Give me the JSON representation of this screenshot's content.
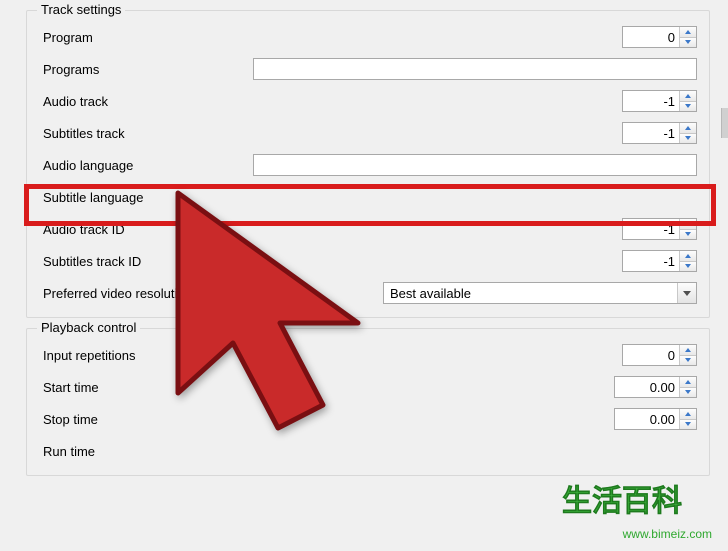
{
  "groups": {
    "track": {
      "title": "Track settings",
      "program": {
        "label": "Program",
        "value": "0"
      },
      "programs": {
        "label": "Programs",
        "value": ""
      },
      "audio_track": {
        "label": "Audio track",
        "value": "-1"
      },
      "subtitles_track": {
        "label": "Subtitles track",
        "value": "-1"
      },
      "audio_language": {
        "label": "Audio language",
        "value": ""
      },
      "subtitle_language": {
        "label": "Subtitle language",
        "value": ""
      },
      "audio_track_id": {
        "label": "Audio track ID",
        "value": "-1"
      },
      "subtitles_track_id": {
        "label": "Subtitles track ID",
        "value": "-1"
      },
      "preferred_video_res": {
        "label": "Preferred video resolution",
        "selected": "Best available"
      }
    },
    "playback": {
      "title": "Playback control",
      "input_repetitions": {
        "label": "Input repetitions",
        "value": "0"
      },
      "start_time": {
        "label": "Start time",
        "value": "0.00"
      },
      "stop_time": {
        "label": "Stop time",
        "value": "0.00"
      },
      "run_time": {
        "label": "Run time",
        "value": ""
      }
    }
  },
  "watermark": {
    "text": "生活百科",
    "url": "www.bimeiz.com"
  }
}
